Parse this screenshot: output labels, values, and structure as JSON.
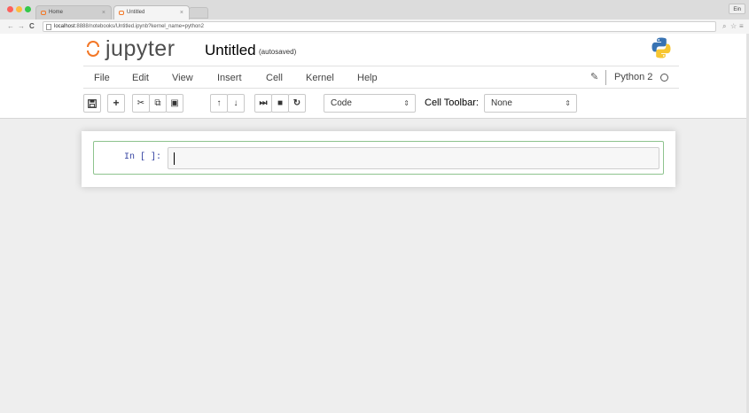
{
  "browser": {
    "tabs": [
      {
        "label": "Home",
        "close": "×"
      },
      {
        "label": "Untitled",
        "close": "×"
      }
    ],
    "user_label": "Ein",
    "url": {
      "host": "localhost",
      "rest": ":8888/notebooks/Untitled.ipynb?kernel_name=python2"
    }
  },
  "header": {
    "logo_text": "jupyter",
    "notebook_name": "Untitled",
    "autosave_status": "(autosaved)"
  },
  "menubar": {
    "items": [
      "File",
      "Edit",
      "View",
      "Insert",
      "Cell",
      "Kernel",
      "Help"
    ],
    "kernel_name": "Python 2"
  },
  "toolbar": {
    "cell_type": "Code",
    "cell_toolbar_label": "Cell Toolbar:",
    "cell_toolbar_value": "None"
  },
  "cell": {
    "prompt": "In [ ]:"
  },
  "colors": {
    "jupyter_orange": "#f37726",
    "cell_border": "#8ec38e",
    "prompt_blue": "#303f9f"
  }
}
